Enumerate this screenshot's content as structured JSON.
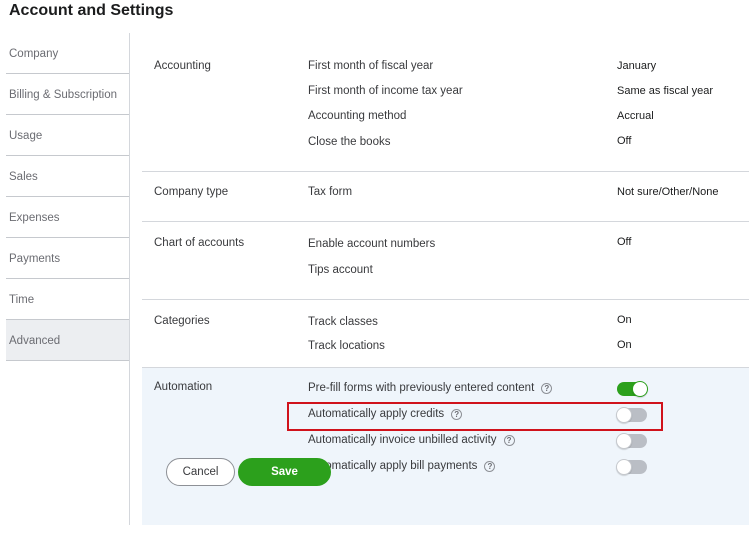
{
  "page": {
    "title": "Account and Settings"
  },
  "sidebar": {
    "items": [
      {
        "label": "Company"
      },
      {
        "label": "Billing & Subscription"
      },
      {
        "label": "Usage"
      },
      {
        "label": "Sales"
      },
      {
        "label": "Expenses"
      },
      {
        "label": "Payments"
      },
      {
        "label": "Time"
      },
      {
        "label": "Advanced",
        "active": true
      }
    ]
  },
  "sections": {
    "accounting": {
      "label": "Accounting",
      "rows": [
        {
          "label": "First month of fiscal year",
          "value": "January"
        },
        {
          "label": "First month of income tax year",
          "value": "Same as fiscal year"
        },
        {
          "label": "Accounting method",
          "value": "Accrual"
        },
        {
          "label": "Close the books",
          "value": "Off"
        }
      ]
    },
    "company_type": {
      "label": "Company type",
      "rows": [
        {
          "label": "Tax form",
          "value": "Not sure/Other/None"
        }
      ]
    },
    "chart_of_accounts": {
      "label": "Chart of accounts",
      "rows": [
        {
          "label": "Enable account numbers",
          "value": "Off"
        },
        {
          "label": "Tips account",
          "value": ""
        }
      ]
    },
    "categories": {
      "label": "Categories",
      "rows": [
        {
          "label": "Track classes",
          "value": "On"
        },
        {
          "label": "Track locations",
          "value": "On"
        }
      ]
    },
    "automation": {
      "label": "Automation",
      "rows": [
        {
          "label": "Pre-fill forms with previously entered content",
          "help": "?",
          "enabled": true
        },
        {
          "label": "Automatically apply credits",
          "help": "?",
          "enabled": false
        },
        {
          "label": "Automatically invoice unbilled activity",
          "help": "?",
          "enabled": false
        },
        {
          "label": "Automatically apply bill payments",
          "help": "?",
          "enabled": false
        }
      ]
    }
  },
  "actions": {
    "cancel_label": "Cancel",
    "save_label": "Save"
  },
  "colors": {
    "accent_green": "#2ca01c",
    "highlight_red": "#d0121b",
    "toggle_off": "#babec5",
    "automation_bg": "#eff5fb"
  },
  "icons": {
    "help": "help-circle-icon"
  }
}
